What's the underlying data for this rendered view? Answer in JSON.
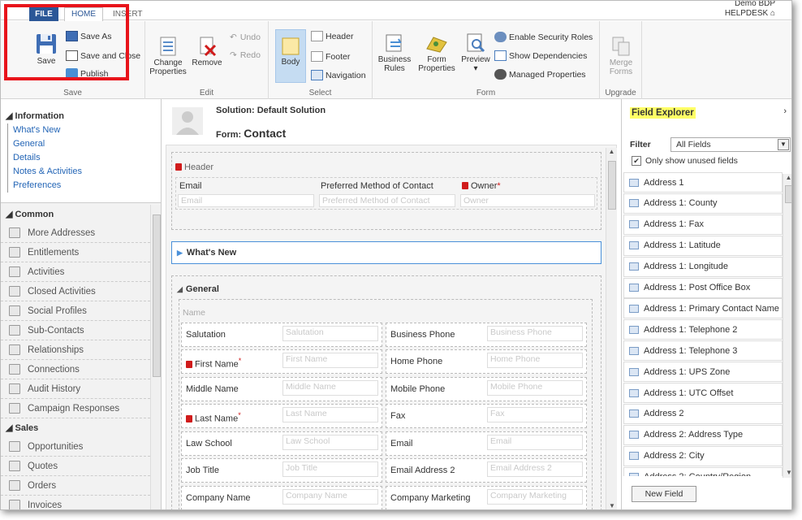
{
  "ribbon": {
    "tabs": {
      "file": "FILE",
      "home": "HOME",
      "insert": "INSERT"
    },
    "user": {
      "name": "Demo BDP",
      "org": "HELPDESK"
    },
    "save_group": {
      "label": "Save",
      "save": "Save",
      "save_as": "Save As",
      "save_close": "Save and Close",
      "publish": "Publish"
    },
    "edit_group": {
      "label": "Edit",
      "change_properties": "Change Properties",
      "remove": "Remove",
      "undo": "Undo",
      "redo": "Redo"
    },
    "select_group": {
      "label": "Select",
      "body": "Body",
      "header": "Header",
      "footer": "Footer",
      "navigation": "Navigation"
    },
    "form_group": {
      "label": "Form",
      "business_rules": "Business Rules",
      "form_properties": "Form Properties",
      "preview": "Preview",
      "enable_security": "Enable Security Roles",
      "show_dependencies": "Show Dependencies",
      "managed_properties": "Managed Properties"
    },
    "upgrade_group": {
      "label": "Upgrade",
      "merge_forms": "Merge Forms"
    }
  },
  "nav": {
    "information": {
      "title": "Information",
      "links": [
        "What's New",
        "General",
        "Details",
        "Notes & Activities",
        "Preferences"
      ]
    },
    "common": {
      "title": "Common",
      "items": [
        "More Addresses",
        "Entitlements",
        "Activities",
        "Closed Activities",
        "Social Profiles",
        "Sub-Contacts",
        "Relationships",
        "Connections",
        "Audit History",
        "Campaign Responses"
      ]
    },
    "sales": {
      "title": "Sales",
      "items": [
        "Opportunities",
        "Quotes",
        "Orders",
        "Invoices"
      ]
    }
  },
  "form": {
    "solution": "Solution: Default Solution",
    "form_prefix": "Form:",
    "form_name": "Contact",
    "header_label": "Header",
    "header_fields": [
      {
        "label": "Email",
        "placeholder": "Email"
      },
      {
        "label": "Preferred Method of Contact",
        "placeholder": "Preferred Method of Contact"
      },
      {
        "label": "Owner",
        "placeholder": "Owner"
      }
    ],
    "whats_new": "What's New",
    "general": "General",
    "name_section": "Name",
    "left_fields": [
      {
        "label": "Salutation",
        "placeholder": "Salutation"
      },
      {
        "label": "First Name",
        "placeholder": "First Name"
      },
      {
        "label": "Middle Name",
        "placeholder": "Middle Name"
      },
      {
        "label": "Last Name",
        "placeholder": "Last Name"
      },
      {
        "label": "Law School",
        "placeholder": "Law School"
      },
      {
        "label": "Job Title",
        "placeholder": "Job Title"
      },
      {
        "label": "Company Name",
        "placeholder": "Company Name"
      }
    ],
    "right_fields": [
      {
        "label": "Business Phone",
        "placeholder": "Business Phone"
      },
      {
        "label": "Home Phone",
        "placeholder": "Home Phone"
      },
      {
        "label": "Mobile Phone",
        "placeholder": "Mobile Phone"
      },
      {
        "label": "Fax",
        "placeholder": "Fax"
      },
      {
        "label": "Email",
        "placeholder": "Email"
      },
      {
        "label": "Email Address 2",
        "placeholder": "Email Address 2"
      },
      {
        "label": "Company Marketing",
        "placeholder": "Company Marketing"
      }
    ],
    "required_mark": "*"
  },
  "field_explorer": {
    "title": "Field Explorer",
    "filter_label": "Filter",
    "filter_value": "All Fields",
    "only_unused": "Only show unused fields",
    "fields": [
      "Address 1",
      "Address 1: County",
      "Address 1: Fax",
      "Address 1: Latitude",
      "Address 1: Longitude",
      "Address 1: Post Office Box",
      "Address 1: Primary Contact Name",
      "Address 1: Telephone 2",
      "Address 1: Telephone 3",
      "Address 1: UPS Zone",
      "Address 1: UTC Offset",
      "Address 2",
      "Address 2: Address Type",
      "Address 2: City",
      "Address 2: Country/Region"
    ],
    "new_field": "New Field"
  },
  "colors": {
    "file_tab": "#2b5797",
    "link": "#2365b6",
    "highlight": "#ffff66",
    "annotation": "#e8141b",
    "selected_body": "#c5dcf2"
  }
}
